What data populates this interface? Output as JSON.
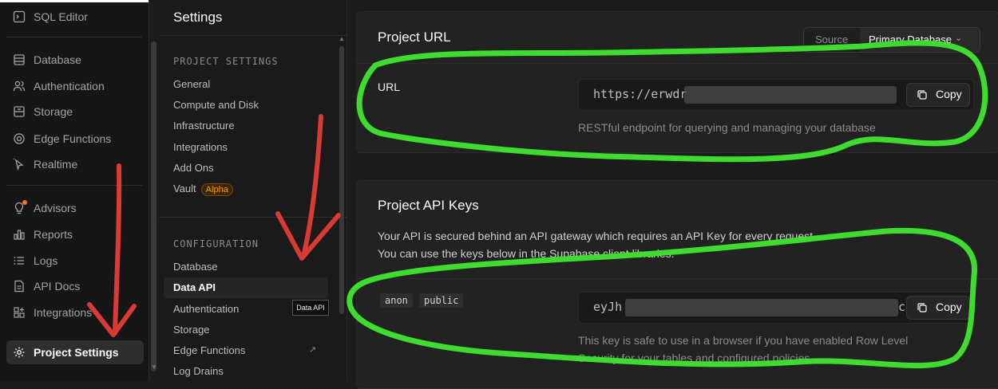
{
  "primary_nav": {
    "items": [
      {
        "label": "SQL Editor",
        "icon": "terminal-icon"
      },
      {
        "label": "Database",
        "icon": "database-icon"
      },
      {
        "label": "Authentication",
        "icon": "users-icon"
      },
      {
        "label": "Storage",
        "icon": "archive-icon"
      },
      {
        "label": "Edge Functions",
        "icon": "edge-functions-icon"
      },
      {
        "label": "Realtime",
        "icon": "cursor-icon"
      },
      {
        "label": "Advisors",
        "icon": "lightbulb-icon"
      },
      {
        "label": "Reports",
        "icon": "bar-chart-icon"
      },
      {
        "label": "Logs",
        "icon": "list-icon"
      },
      {
        "label": "API Docs",
        "icon": "document-icon"
      },
      {
        "label": "Integrations",
        "icon": "grid-plus-icon"
      },
      {
        "label": "Project Settings",
        "icon": "gear-icon",
        "active": true
      }
    ]
  },
  "settings_sidebar": {
    "title": "Settings",
    "project_settings_label": "PROJECT SETTINGS",
    "project_items": [
      "General",
      "Compute and Disk",
      "Infrastructure",
      "Integrations",
      "Add Ons",
      "Vault"
    ],
    "vault_badge": "Alpha",
    "configuration_label": "CONFIGURATION",
    "configuration_items": [
      "Database",
      "Data API",
      "Authentication",
      "Storage",
      "Edge Functions",
      "Log Drains"
    ],
    "active_item": "Data API",
    "tooltip": "Data API"
  },
  "project_url_card": {
    "title": "Project URL",
    "source_label": "Source",
    "source_value": "Primary Database",
    "field_label": "URL",
    "url_visible": "https://erwdr",
    "copy_label": "Copy",
    "help_text": "RESTful endpoint for querying and managing your database"
  },
  "api_keys_card": {
    "title": "Project API Keys",
    "description_line1": "Your API is secured behind an API gateway which requires an API Key for every request.",
    "description_line2": "You can use the keys below in the Supabase client libraries.",
    "tags": [
      "anon",
      "public"
    ],
    "key_visible": "eyJh",
    "key_tail": "c",
    "copy_label": "Copy",
    "help_line1": "This key is safe to use in a browser if you have enabled Row Level",
    "help_line2": "Security for your tables and configured policies."
  },
  "colors": {
    "annotation_green": "#3ddc2f",
    "annotation_red": "#d93a33",
    "alpha_badge": "#f59e0b"
  }
}
